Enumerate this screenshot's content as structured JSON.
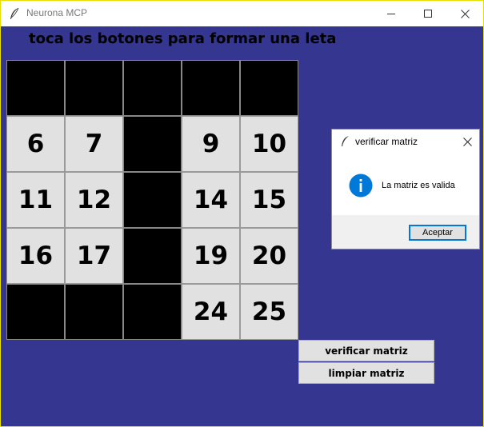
{
  "window": {
    "title": "Neurona MCP",
    "background_color": "#34368f",
    "icon": "feather-icon"
  },
  "heading": "toca los botones para formar una leta",
  "grid": {
    "cells": [
      {
        "label": "",
        "active": false
      },
      {
        "label": "",
        "active": false
      },
      {
        "label": "",
        "active": false
      },
      {
        "label": "",
        "active": false
      },
      {
        "label": "",
        "active": false
      },
      {
        "label": "6",
        "active": true
      },
      {
        "label": "7",
        "active": true
      },
      {
        "label": "",
        "active": false
      },
      {
        "label": "9",
        "active": true
      },
      {
        "label": "10",
        "active": true
      },
      {
        "label": "11",
        "active": true
      },
      {
        "label": "12",
        "active": true
      },
      {
        "label": "",
        "active": false
      },
      {
        "label": "14",
        "active": true
      },
      {
        "label": "15",
        "active": true
      },
      {
        "label": "16",
        "active": true
      },
      {
        "label": "17",
        "active": true
      },
      {
        "label": "",
        "active": false
      },
      {
        "label": "19",
        "active": true
      },
      {
        "label": "20",
        "active": true
      },
      {
        "label": "",
        "active": false
      },
      {
        "label": "",
        "active": false
      },
      {
        "label": "",
        "active": false
      },
      {
        "label": "24",
        "active": true
      },
      {
        "label": "25",
        "active": true
      }
    ]
  },
  "buttons": {
    "verify": "verificar matriz",
    "clear": "limpiar matriz"
  },
  "dialog": {
    "title": "verificar matriz",
    "message": "La matriz es valida",
    "ok": "Aceptar",
    "icon": "info-icon",
    "accent": "#0078d7"
  }
}
